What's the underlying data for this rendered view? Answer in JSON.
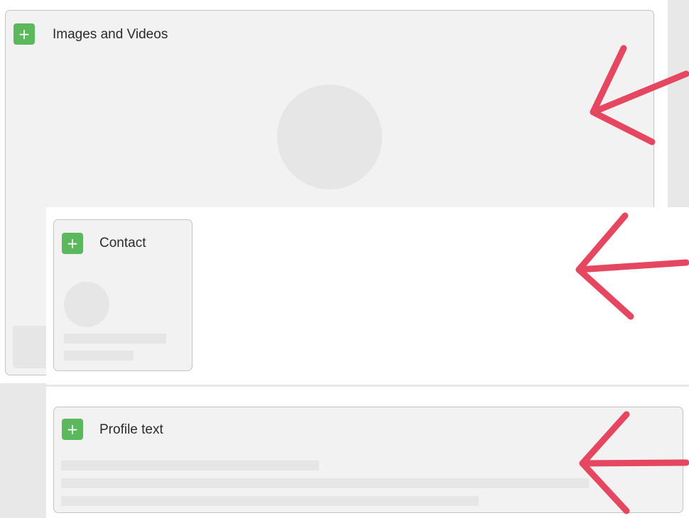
{
  "sections": [
    {
      "id": "images",
      "title": "Images and Videos",
      "add_label": "+"
    },
    {
      "id": "contact",
      "title": "Contact",
      "add_label": "+"
    },
    {
      "id": "profile",
      "title": "Profile text",
      "add_label": "+"
    }
  ],
  "colors": {
    "add_button": "#5cb85c",
    "arrow": "#e4475f",
    "card_background": "#f2f2f2",
    "placeholder": "#e6e6e6"
  },
  "icons": {
    "add": "plus-icon",
    "annotation": "arrow-left-icon"
  }
}
